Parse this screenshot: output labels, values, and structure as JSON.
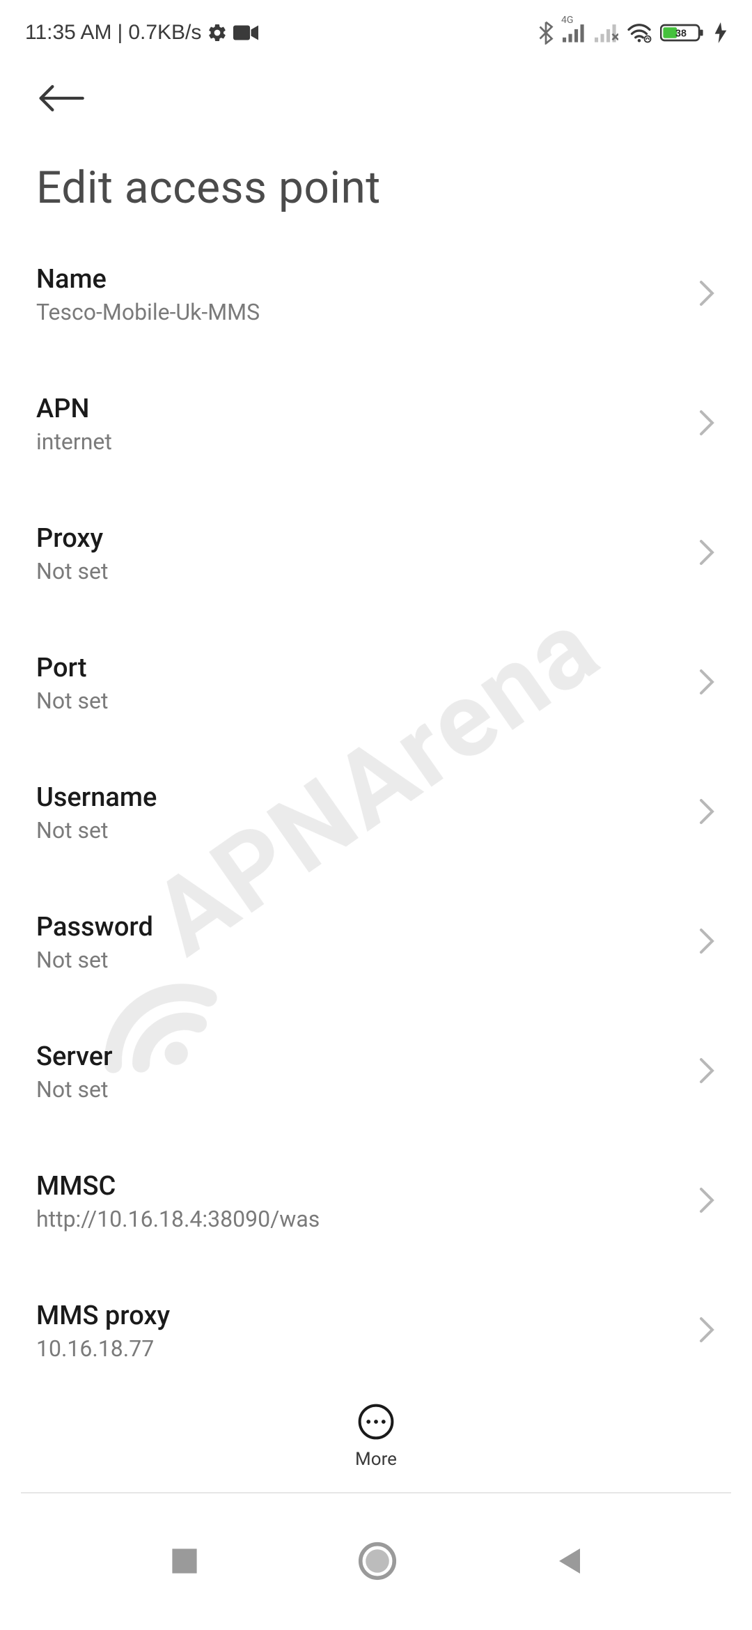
{
  "status_bar": {
    "time": "11:35 AM",
    "separator": "|",
    "speed": "0.7KB/s",
    "battery_pct": "38"
  },
  "header": {
    "title": "Edit access point"
  },
  "settings": {
    "items": [
      {
        "label": "Name",
        "value": "Tesco-Mobile-Uk-MMS"
      },
      {
        "label": "APN",
        "value": "internet"
      },
      {
        "label": "Proxy",
        "value": "Not set"
      },
      {
        "label": "Port",
        "value": "Not set"
      },
      {
        "label": "Username",
        "value": "Not set"
      },
      {
        "label": "Password",
        "value": "Not set"
      },
      {
        "label": "Server",
        "value": "Not set"
      },
      {
        "label": "MMSC",
        "value": "http://10.16.18.4:38090/was"
      },
      {
        "label": "MMS proxy",
        "value": "10.16.18.77"
      }
    ]
  },
  "footer": {
    "more_label": "More"
  },
  "watermark": "APNArena"
}
